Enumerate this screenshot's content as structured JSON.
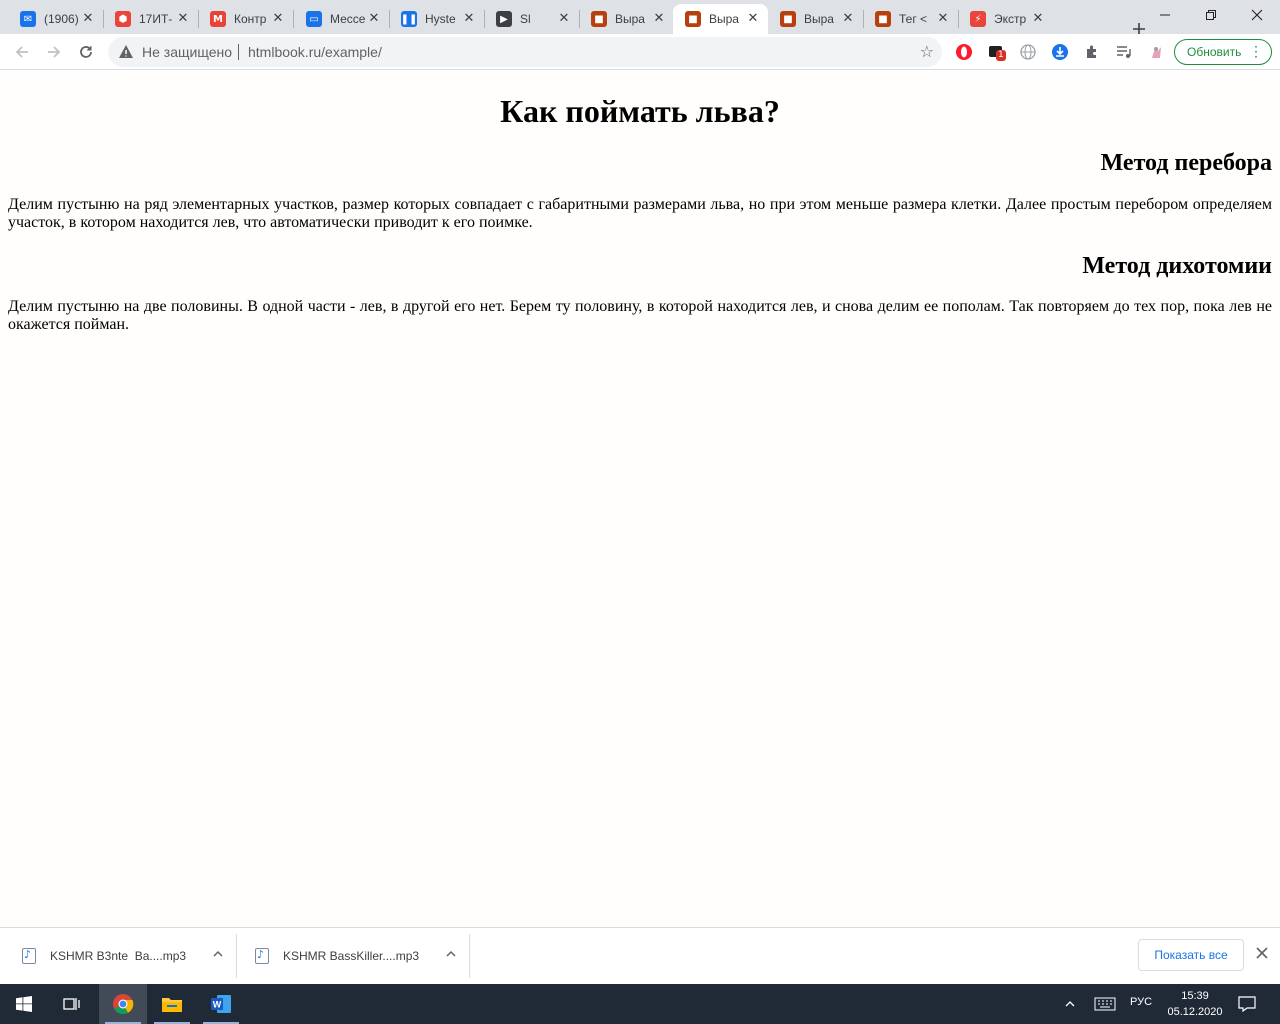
{
  "browser": {
    "tabs": [
      {
        "label": "(1906)",
        "icon": "mail-icon",
        "color": "#1a73e8",
        "glyph": "✉"
      },
      {
        "label": "17ИТ-",
        "icon": "colorful-hexagon-icon",
        "color": "#e8453c",
        "glyph": "⬢"
      },
      {
        "label": "Контр",
        "icon": "gmail-icon",
        "color": "#ea4335",
        "glyph": "M"
      },
      {
        "label": "Мессе",
        "icon": "messenger-icon",
        "color": "#1a73e8",
        "glyph": "▭"
      },
      {
        "label": "Hyste",
        "icon": "pause-icon",
        "color": "#1a73e8",
        "glyph": "❚❚"
      },
      {
        "label": "Sl",
        "icon": "play-icon",
        "color": "#3c4043",
        "glyph": "▶"
      },
      {
        "label": "Выра",
        "icon": "htmlbook-icon",
        "color": "#b7410e",
        "glyph": "■"
      },
      {
        "label": "Выра",
        "icon": "htmlbook-icon",
        "color": "#b7410e",
        "glyph": "■"
      },
      {
        "label": "Выра",
        "icon": "htmlbook-icon",
        "color": "#b7410e",
        "glyph": "■"
      },
      {
        "label": "Тег <",
        "icon": "htmlbook-icon",
        "color": "#b7410e",
        "glyph": "■"
      },
      {
        "label": "Экстр",
        "icon": "lightning-icon",
        "color": "#e8453c",
        "glyph": "⚡"
      }
    ],
    "active_tab": 7,
    "security_label": "Не защищено",
    "url": "htmlbook.ru/example/",
    "update_label": "Обновить",
    "extension_badge": "1"
  },
  "page": {
    "title": "Как поймать льва?",
    "sections": [
      {
        "heading": "Метод перебора",
        "text": "Делим пустыню на ряд элементарных участков, размер которых совпадает с габаритными размерами льва, но при этом меньше размера клетки. Далее простым перебором определяем участок, в котором находится лев, что автоматически приводит к его поимке."
      },
      {
        "heading": "Метод дихотомии",
        "text": "Делим пустыню на две половины. В одной части - лев, в другой его нет. Берем ту половину, в которой находится лев, и снова делим ее пополам. Так повторяем до тех пор, пока лев не окажется пойман."
      }
    ]
  },
  "downloads": {
    "items": [
      {
        "name": "KSHMR B3nte  Ba....mp3"
      },
      {
        "name": "KSHMR BassKiller....mp3"
      }
    ],
    "show_all_label": "Показать все"
  },
  "taskbar": {
    "language": "РУС",
    "time": "15:39",
    "date": "05.12.2020"
  }
}
